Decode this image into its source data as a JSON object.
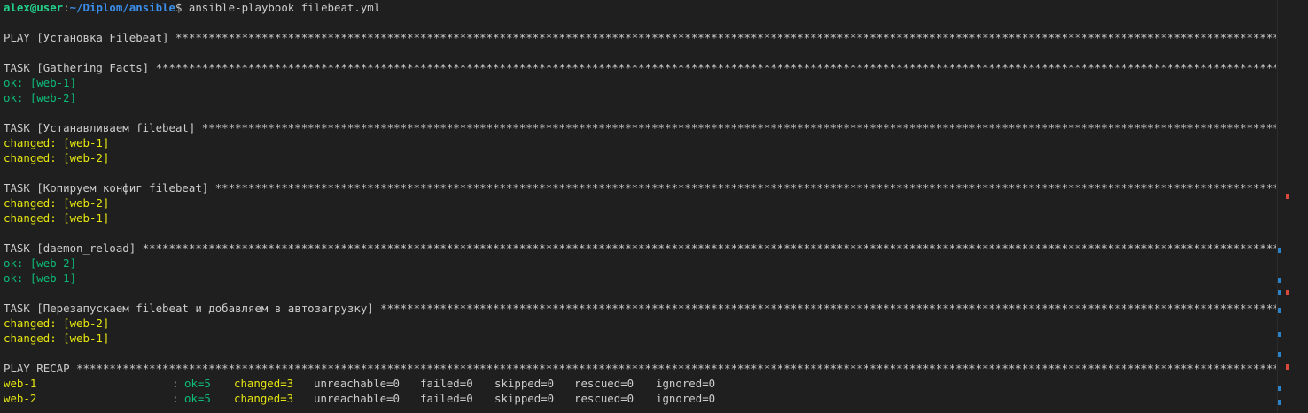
{
  "prompt": {
    "user": "alex@user",
    "separator": ":",
    "path": "~/Diplom/ansible",
    "symbol": "$ ",
    "command": "ansible-playbook filebeat.yml"
  },
  "play": {
    "header": "PLAY [Установка Filebeat] "
  },
  "tasks": [
    {
      "header": "TASK [Gathering Facts] ",
      "results": [
        {
          "status": "ok",
          "text": "ok: [web-1]"
        },
        {
          "status": "ok",
          "text": "ok: [web-2]"
        }
      ]
    },
    {
      "header": "TASK [Устанавливаем filebeat] ",
      "results": [
        {
          "status": "changed",
          "text": "changed: [web-1]"
        },
        {
          "status": "changed",
          "text": "changed: [web-2]"
        }
      ]
    },
    {
      "header": "TASK [Копируем конфиг filebeat] ",
      "results": [
        {
          "status": "changed",
          "text": "changed: [web-2]"
        },
        {
          "status": "changed",
          "text": "changed: [web-1]"
        }
      ]
    },
    {
      "header": "TASK [daemon_reload] ",
      "results": [
        {
          "status": "ok",
          "text": "ok: [web-2]"
        },
        {
          "status": "ok",
          "text": "ok: [web-1]"
        }
      ]
    },
    {
      "header": "TASK [Перезапускаем filebeat и добавляем в автозагрузку] ",
      "results": [
        {
          "status": "changed",
          "text": "changed: [web-2]"
        },
        {
          "status": "changed",
          "text": "changed: [web-1]"
        }
      ]
    }
  ],
  "recap": {
    "header": "PLAY RECAP ",
    "rows": [
      {
        "host": "web-1",
        "colon": ":",
        "ok": "ok=5",
        "changed": "changed=3",
        "unreachable": "unreachable=0",
        "failed": "failed=0",
        "skipped": "skipped=0",
        "rescued": "rescued=0",
        "ignored": "ignored=0"
      },
      {
        "host": "web-2",
        "colon": ":",
        "ok": "ok=5",
        "changed": "changed=3",
        "unreachable": "unreachable=0",
        "failed": "failed=0",
        "skipped": "skipped=0",
        "rescued": "rescued=0",
        "ignored": "ignored=0"
      }
    ]
  },
  "colors": {
    "background": "#1f1f1f",
    "text": "#cccccc",
    "ok": "#0dbc79",
    "changed": "#e5e510",
    "prompt_user": "#23d18b",
    "prompt_path": "#3b8eea"
  }
}
